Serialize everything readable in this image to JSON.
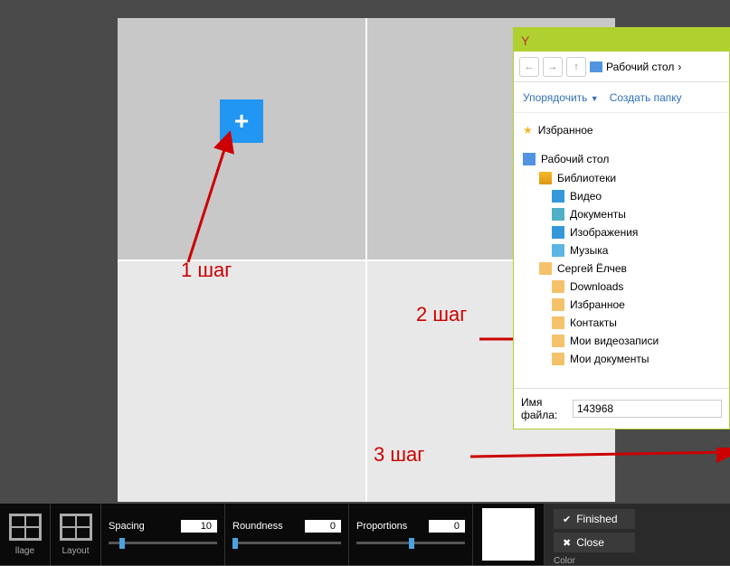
{
  "steps": {
    "s1": "1 шаг",
    "s2": "2 шаг",
    "s3": "3 шаг"
  },
  "add_symbol": "+",
  "dialog": {
    "nav": {
      "back": "←",
      "fwd": "→",
      "up": "↑",
      "location": "Рабочий стол",
      "location_arrow": "›"
    },
    "toolbar": {
      "organize": "Упорядочить",
      "newfolder": "Создать папку"
    },
    "tree": {
      "favorites": "Избранное",
      "desktop": "Рабочий стол",
      "libraries": "Библиотеки",
      "video": "Видео",
      "documents": "Документы",
      "images": "Изображения",
      "music": "Музыка",
      "user": "Сергей Ёлчев",
      "downloads": "Downloads",
      "fav2": "Избранное",
      "contacts": "Контакты",
      "myvideos": "Мои видеозаписи",
      "mydocs": "Мои документы"
    },
    "filename_label": "Имя файла:",
    "filename_value": "143968"
  },
  "toolbar": {
    "collage": "llage",
    "layout": "Layout",
    "spacing": {
      "label": "Spacing",
      "value": "10"
    },
    "roundness": {
      "label": "Roundness",
      "value": "0"
    },
    "proportions": {
      "label": "Proportions",
      "value": "0"
    },
    "finished": "Finished",
    "close": "Close",
    "color": "Color"
  }
}
